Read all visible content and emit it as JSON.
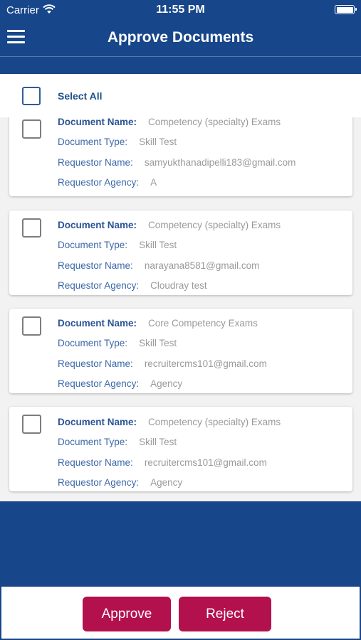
{
  "status_bar": {
    "carrier": "Carrier",
    "time": "11:55 PM"
  },
  "nav": {
    "title": "Approve Documents"
  },
  "select_all": {
    "label": "Select All"
  },
  "labels": {
    "document_name": "Document Name:",
    "document_type": "Document Type:",
    "requestor_name": "Requestor Name:",
    "requestor_agency": "Requestor Agency:"
  },
  "documents": [
    {
      "document_name": "Competency (specialty) Exams",
      "document_type": "Skill Test",
      "requestor_name": "samyukthanadipelli183@gmail.com",
      "requestor_agency": "A"
    },
    {
      "document_name": "Competency (specialty) Exams",
      "document_type": "Skill Test",
      "requestor_name": "narayana8581@gmail.com",
      "requestor_agency": "Cloudray test"
    },
    {
      "document_name": "Core Competency Exams",
      "document_type": "Skill Test",
      "requestor_name": "recruitercms101@gmail.com",
      "requestor_agency": "Agency"
    },
    {
      "document_name": "Competency (specialty) Exams",
      "document_type": "Skill Test",
      "requestor_name": "recruitercms101@gmail.com",
      "requestor_agency": "Agency"
    }
  ],
  "actions": {
    "approve": "Approve",
    "reject": "Reject"
  },
  "colors": {
    "header": "#17468a",
    "action": "#b3104e",
    "label": "#3c68a8"
  }
}
